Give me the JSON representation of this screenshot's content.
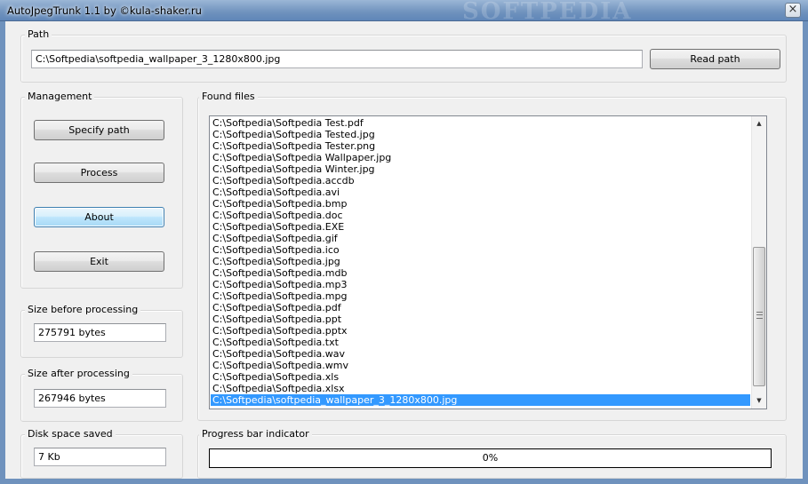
{
  "window": {
    "title": "AutoJpegTrunk 1.1 by ©kula-shaker.ru",
    "watermark": "SOFTPEDIA",
    "close_glyph": "×"
  },
  "path": {
    "group_label": "Path",
    "value": "C:\\Softpedia\\softpedia_wallpaper_3_1280x800.jpg",
    "read_button": "Read path"
  },
  "management": {
    "group_label": "Management",
    "specify_button": "Specify path",
    "process_button": "Process",
    "about_button": "About",
    "exit_button": "Exit"
  },
  "size_before": {
    "label": "Size before processing",
    "value": "275791 bytes"
  },
  "size_after": {
    "label": "Size after processing",
    "value": "267946 bytes"
  },
  "disk_saved": {
    "label": "Disk space saved",
    "value": "7 Kb"
  },
  "found_files": {
    "label": "Found files",
    "items": [
      "C:\\Softpedia\\Softpedia Test.pdf",
      "C:\\Softpedia\\Softpedia Tested.jpg",
      "C:\\Softpedia\\Softpedia Tester.png",
      "C:\\Softpedia\\Softpedia Wallpaper.jpg",
      "C:\\Softpedia\\Softpedia Winter.jpg",
      "C:\\Softpedia\\Softpedia.accdb",
      "C:\\Softpedia\\Softpedia.avi",
      "C:\\Softpedia\\Softpedia.bmp",
      "C:\\Softpedia\\Softpedia.doc",
      "C:\\Softpedia\\Softpedia.EXE",
      "C:\\Softpedia\\Softpedia.gif",
      "C:\\Softpedia\\Softpedia.ico",
      "C:\\Softpedia\\Softpedia.jpg",
      "C:\\Softpedia\\Softpedia.mdb",
      "C:\\Softpedia\\Softpedia.mp3",
      "C:\\Softpedia\\Softpedia.mpg",
      "C:\\Softpedia\\Softpedia.pdf",
      "C:\\Softpedia\\Softpedia.ppt",
      "C:\\Softpedia\\Softpedia.pptx",
      "C:\\Softpedia\\Softpedia.txt",
      "C:\\Softpedia\\Softpedia.wav",
      "C:\\Softpedia\\Softpedia.wmv",
      "C:\\Softpedia\\Softpedia.xls",
      "C:\\Softpedia\\Softpedia.xlsx",
      "C:\\Softpedia\\softpedia_wallpaper_3_1280x800.jpg"
    ],
    "selected_index": 24,
    "scroll_up_glyph": "▲",
    "scroll_down_glyph": "▼"
  },
  "progress": {
    "label": "Progress bar indicator",
    "value_text": "0%",
    "value": 0
  },
  "colors": {
    "selection": "#3399ff",
    "titlebar": "#6f92bd"
  }
}
